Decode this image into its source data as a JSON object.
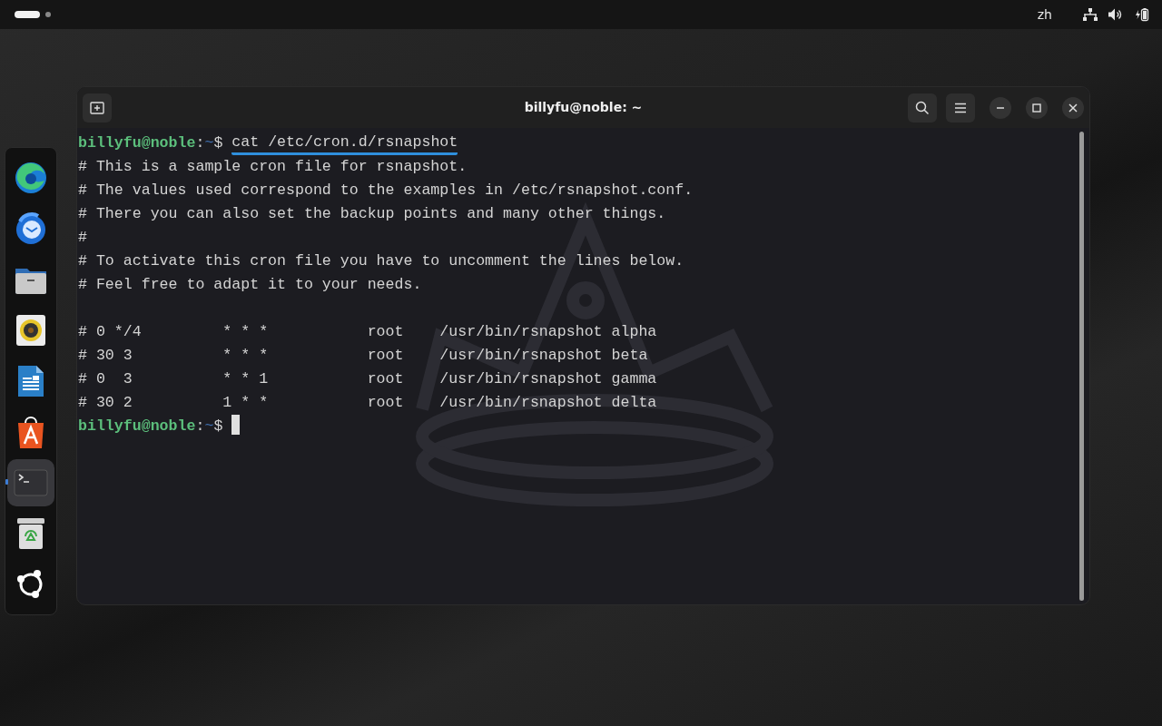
{
  "top_bar": {
    "workspaces": [
      {
        "selected": true
      },
      {
        "selected": false
      }
    ],
    "input_source": "zh"
  },
  "dock": {
    "items": [
      {
        "kind": "browser",
        "running": false,
        "active": false
      },
      {
        "kind": "mail",
        "running": false,
        "active": false
      },
      {
        "kind": "files",
        "running": false,
        "active": false
      },
      {
        "kind": "music",
        "running": false,
        "active": false
      },
      {
        "kind": "writer",
        "running": false,
        "active": false
      },
      {
        "kind": "store",
        "running": false,
        "active": false
      },
      {
        "kind": "terminal",
        "running": true,
        "active": true
      },
      {
        "kind": "trash",
        "running": false,
        "active": false
      },
      {
        "kind": "apps",
        "running": false,
        "active": false
      }
    ]
  },
  "window": {
    "title": "billyfu@noble: ~",
    "terminal": {
      "lines": [
        {
          "kind": "prompt",
          "user_host": "billyfu@noble",
          "separator": ":",
          "path": "~",
          "symbol": "$",
          "command": "cat /etc/cron.d/rsnapshot",
          "underlined": true,
          "cursor": false
        },
        {
          "kind": "output",
          "text": "# This is a sample cron file for rsnapshot."
        },
        {
          "kind": "output",
          "text": "# The values used correspond to the examples in /etc/rsnapshot.conf."
        },
        {
          "kind": "output",
          "text": "# There you can also set the backup points and many other things."
        },
        {
          "kind": "output",
          "text": "#"
        },
        {
          "kind": "output",
          "text": "# To activate this cron file you have to uncomment the lines below."
        },
        {
          "kind": "output",
          "text": "# Feel free to adapt it to your needs."
        },
        {
          "kind": "blank"
        },
        {
          "kind": "output",
          "text": "# 0 */4         * * *           root    /usr/bin/rsnapshot alpha"
        },
        {
          "kind": "output",
          "text": "# 30 3          * * *           root    /usr/bin/rsnapshot beta"
        },
        {
          "kind": "output",
          "text": "# 0  3          * * 1           root    /usr/bin/rsnapshot gamma"
        },
        {
          "kind": "output",
          "text": "# 30 2          1 * *           root    /usr/bin/rsnapshot delta"
        },
        {
          "kind": "prompt",
          "user_host": "billyfu@noble",
          "separator": ":",
          "path": "~",
          "symbol": "$",
          "cursor": true
        }
      ]
    }
  }
}
